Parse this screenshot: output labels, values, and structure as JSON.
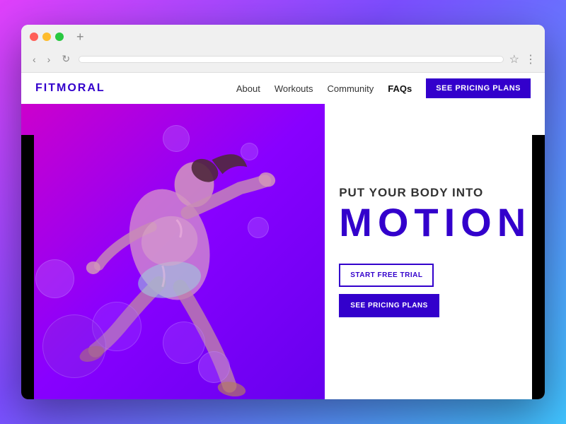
{
  "browser": {
    "dots": [
      "red",
      "yellow",
      "green"
    ],
    "new_tab": "+",
    "nav_back": "‹",
    "nav_forward": "›",
    "nav_refresh": "↻",
    "url": "",
    "star": "☆",
    "menu": "⋮"
  },
  "site": {
    "logo": "FITMORAL",
    "nav": {
      "links": [
        {
          "label": "About",
          "bold": false
        },
        {
          "label": "Workouts",
          "bold": false
        },
        {
          "label": "Community",
          "bold": false
        },
        {
          "label": "FAQs",
          "bold": true
        }
      ],
      "cta": "SEE PRICING PLANS"
    },
    "hero": {
      "subtitle": "PUT YOUR BODY INTO",
      "title": "MOTION",
      "btn_trial": "START FREE TRIAL",
      "btn_pricing": "SEE PRICING PLANS"
    }
  }
}
